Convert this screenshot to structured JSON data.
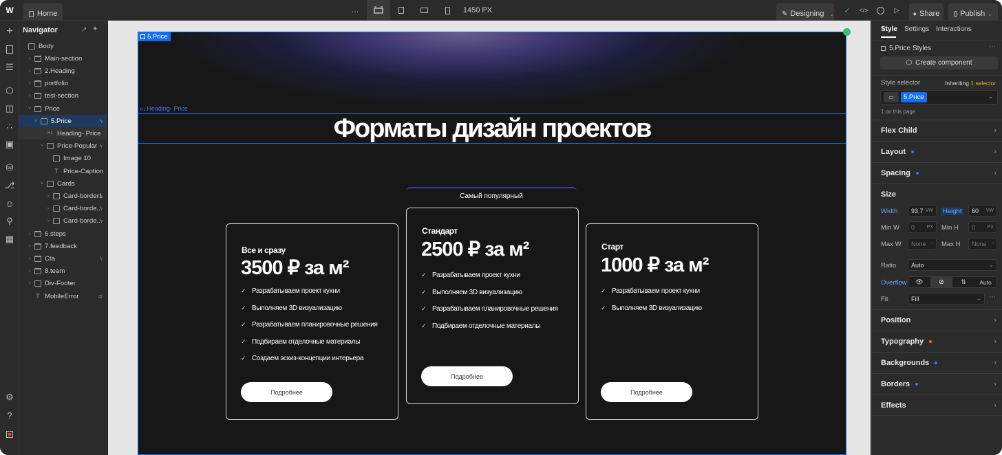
{
  "topbar": {
    "home": "Home",
    "more": "…",
    "width_readout": "1450 PX",
    "mode": "Designing",
    "share": "Share",
    "publish": "Publish"
  },
  "navigator": {
    "title": "Navigator",
    "items": [
      {
        "label": "Body",
        "icon": "box"
      },
      {
        "label": "Main-section",
        "icon": "section"
      },
      {
        "label": "2.Heading",
        "icon": "section"
      },
      {
        "label": "portfolio",
        "icon": "section"
      },
      {
        "label": "test-section",
        "icon": "section"
      },
      {
        "label": "Price",
        "icon": "section"
      },
      {
        "label": "5.Price",
        "icon": "box"
      },
      {
        "label": "Heading- Price",
        "icon": "H1"
      },
      {
        "label": "Price-Popular",
        "icon": "box"
      },
      {
        "label": "Image 10",
        "icon": "image"
      },
      {
        "label": "Price-Caption",
        "icon": "T"
      },
      {
        "label": "Cards",
        "icon": "box"
      },
      {
        "label": "Card-border1",
        "icon": "box"
      },
      {
        "label": "Card-borde...",
        "icon": "box"
      },
      {
        "label": "Card-borde...",
        "icon": "box"
      },
      {
        "label": "6.steps",
        "icon": "section"
      },
      {
        "label": "7.feedback",
        "icon": "section"
      },
      {
        "label": "Cta",
        "icon": "section"
      },
      {
        "label": "8.team",
        "icon": "section"
      },
      {
        "label": "Div-Footer",
        "icon": "box"
      },
      {
        "label": "MobileError",
        "icon": "T"
      }
    ]
  },
  "canvas": {
    "selected_label": "5.Price",
    "heading_label": "Heading- Price",
    "heading": "Форматы дизайн проектов",
    "popular_caption": "Самый популярный",
    "cards": [
      {
        "title": "Все и сразу",
        "price": "3500 ₽ за м²",
        "features": [
          "Разрабатываем проект кухни",
          "Выполняем 3D визуализацию",
          "Разрабатываем планировочные решения",
          "Подбираем отделочные материалы",
          "Создаем эскиз-концепции интерьера"
        ],
        "button": "Подробнее"
      },
      {
        "title": "Стандарт",
        "price": "2500 ₽ за м²",
        "features": [
          "Разрабатываем проект кухни",
          "Выполняем 3D визуализацию",
          "Разрабатываем планировочные решения",
          "Подбираем отделочные материалы"
        ],
        "button": "Подробнее"
      },
      {
        "title": "Старт",
        "price": "1000 ₽ за м²",
        "features": [
          "Разрабатываем проект кухни",
          "Выполняем 3D визуализацию"
        ],
        "button": "Подробнее"
      }
    ]
  },
  "panel": {
    "tabs": [
      "Style",
      "Settings",
      "Interactions"
    ],
    "styles_title": "5.Price Styles",
    "create_component": "Create component",
    "style_selector": "Style selector",
    "inheriting": "Inheriting",
    "inherit_count": "1",
    "inherit_word": "selector",
    "selector_tag": "5.Price",
    "on_page": "1 on this page",
    "flex_child": "Flex Child",
    "layout": "Layout",
    "spacing": "Spacing",
    "size": "Size",
    "width_label": "Width",
    "width_value": "93.7",
    "width_unit": "VW",
    "height_label": "Height",
    "height_value": "60",
    "height_unit": "VW",
    "minw_label": "Min W",
    "minw_value": "0",
    "minh_label": "Min H",
    "minh_value": "0",
    "px": "PX",
    "maxw_label": "Max W",
    "maxw_value": "None",
    "maxh_label": "Max H",
    "maxh_value": "None",
    "dash": "-",
    "ratio_label": "Ratio",
    "ratio_value": "Auto",
    "overflow_label": "Overflow",
    "overflow_auto": "Auto",
    "fit_label": "Fit",
    "fit_value": "Fill",
    "position": "Position",
    "typography": "Typography",
    "backgrounds": "Backgrounds",
    "borders": "Borders",
    "effects": "Effects"
  },
  "colors": {
    "accent": "#146ef5",
    "panel_bg": "#2b2b2b",
    "canvas_bg": "#171717",
    "typography_dot": "#e8742b"
  }
}
